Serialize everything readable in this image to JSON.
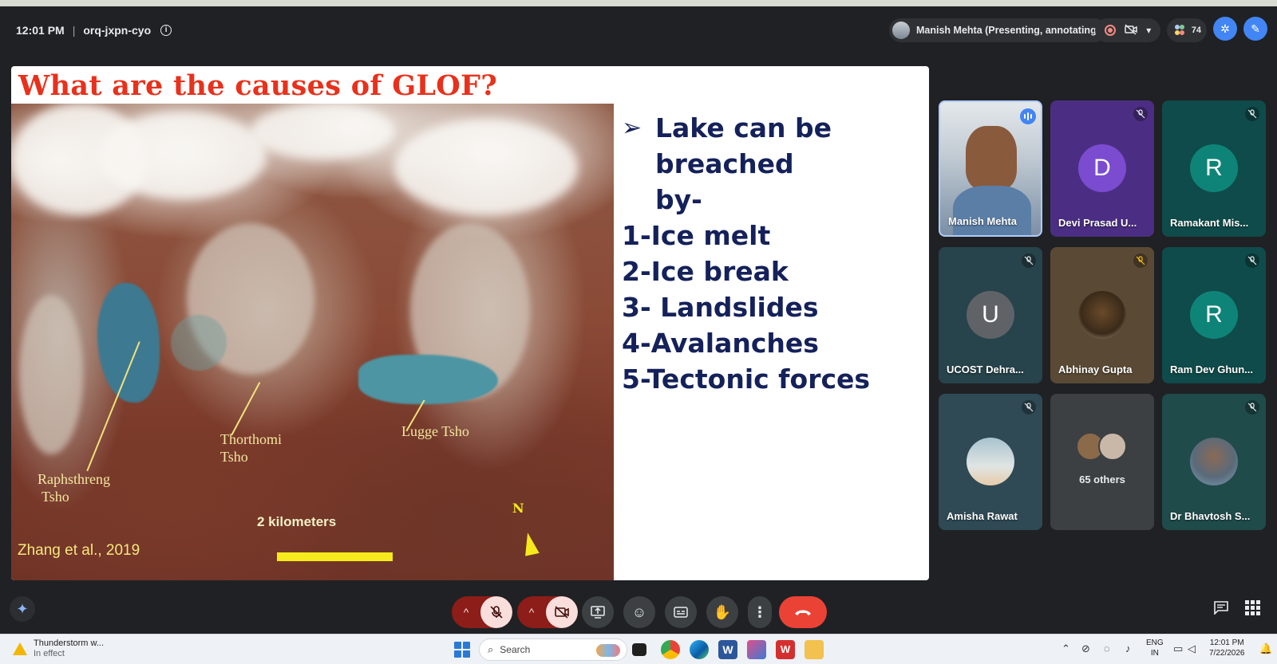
{
  "meeting": {
    "time": "12:01 PM",
    "code": "orq-jxpn-cyo",
    "presenter_chip": "Manish Mehta (Presenting, annotating)",
    "participant_count": "74"
  },
  "slide": {
    "title": "What are the causes of GLOF?",
    "bullet_lead_line1": "Lake can be",
    "bullet_lead_line2": "breached by-",
    "items": [
      "1-Ice melt",
      "2-Ice break",
      "3- Landslides",
      "4-Avalanches",
      "5-Tectonic forces"
    ],
    "image_labels": {
      "raph_line1": "Raphsthreng",
      "raph_line2": "Tsho",
      "thor_line1": "Thorthomi",
      "thor_line2": "Tsho",
      "lugge": "Lugge Tsho",
      "scale": "2 kilometers",
      "north": "N"
    },
    "citation": "Zhang et al., 2019"
  },
  "participants": [
    {
      "name": "Manish Mehta",
      "initial": "",
      "color": "#8fa3b8",
      "speaking": true
    },
    {
      "name": "Devi Prasad U...",
      "initial": "D",
      "color": "#7b4bd0"
    },
    {
      "name": "Ramakant Mis...",
      "initial": "R",
      "color": "#0e8478"
    },
    {
      "name": "UCOST Dehra...",
      "initial": "U",
      "color": "#5f6368"
    },
    {
      "name": "Abhinay Gupta",
      "initial": "",
      "color": "#6b5a43"
    },
    {
      "name": "Ram Dev Ghun...",
      "initial": "R",
      "color": "#0e8478"
    },
    {
      "name": "Amisha Rawat",
      "initial": "",
      "color": "#a8c3cf"
    },
    {
      "name": "65 others",
      "initial": "",
      "color": "#3c4043"
    },
    {
      "name": "Dr Bhavtosh S...",
      "initial": "",
      "color": "#4b7d96"
    }
  ],
  "taskbar": {
    "weather_title": "Thunderstorm w...",
    "weather_sub": "In effect",
    "search_placeholder": "Search",
    "lang_line1": "ENG",
    "lang_line2": "IN",
    "clock_time": "12:01 PM",
    "clock_date": "7/22/2026"
  },
  "colors": {
    "meet_bg": "#202124",
    "slide_title": "#e8311c",
    "slide_text": "#14215a",
    "end_call": "#ea4335",
    "muted_red": "#8c1d18"
  }
}
